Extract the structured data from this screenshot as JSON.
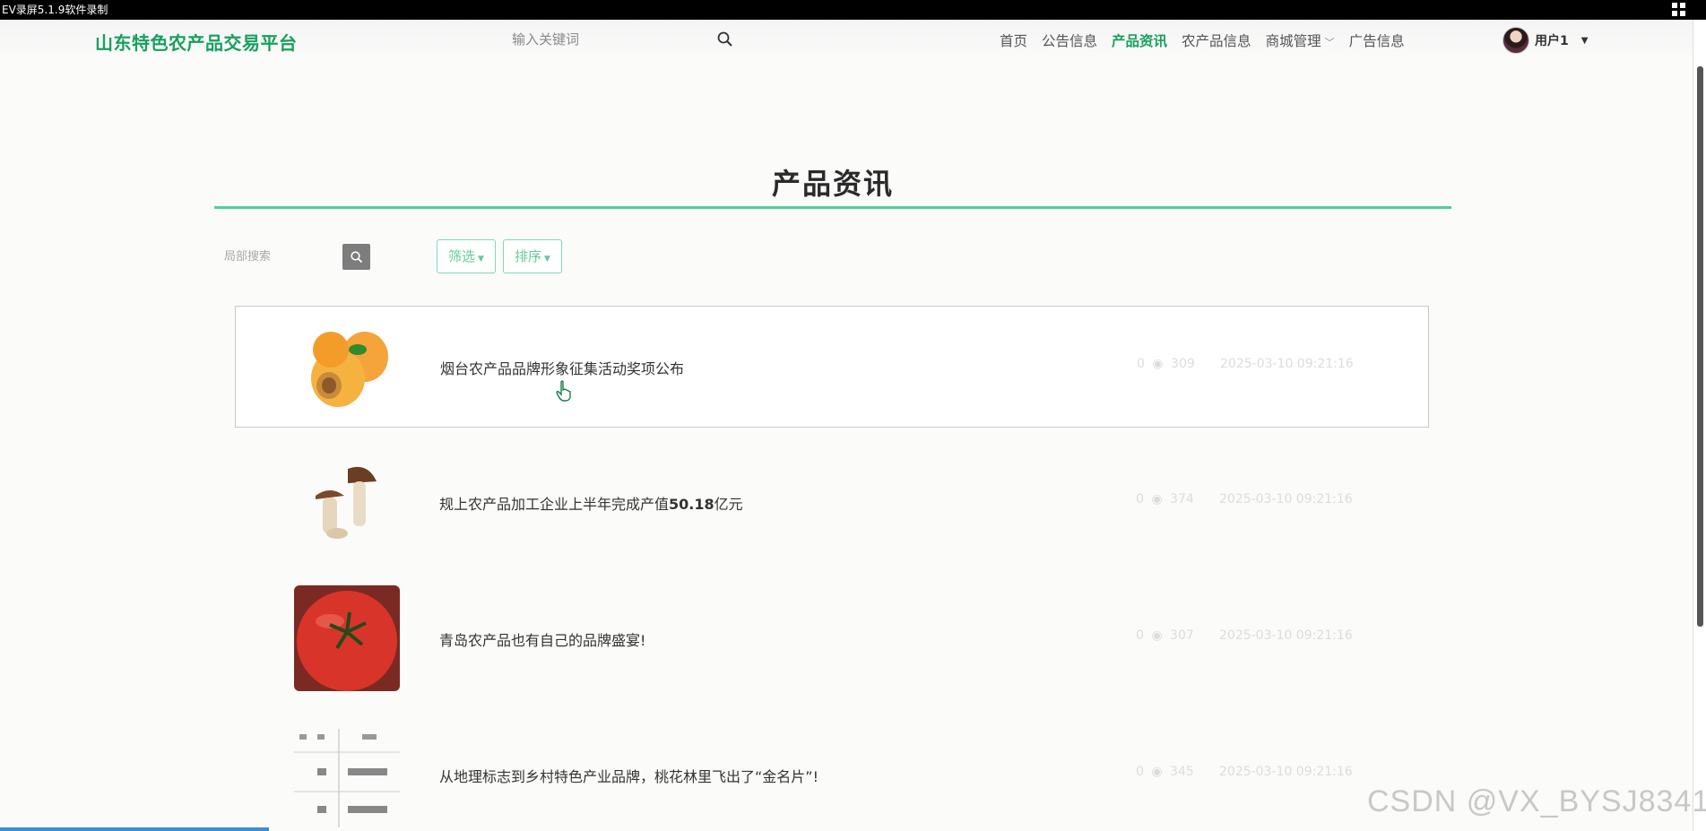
{
  "recorder": {
    "title": "EV录屏5.1.9软件录制"
  },
  "header": {
    "brand": "山东特色农产品交易平台",
    "search_placeholder": "输入关键词",
    "nav": [
      {
        "label": "首页",
        "active": false
      },
      {
        "label": "公告信息",
        "active": false
      },
      {
        "label": "产品资讯",
        "active": true
      },
      {
        "label": "农产品信息",
        "active": false
      },
      {
        "label": "商城管理",
        "active": false,
        "dropdown": true
      },
      {
        "label": "广告信息",
        "active": false
      }
    ],
    "user": {
      "name": "用户1"
    }
  },
  "page": {
    "title": "产品资讯",
    "local_search_placeholder": "局部搜索",
    "filter_label": "筛选",
    "sort_label": "排序"
  },
  "news": [
    {
      "title": "烟台农产品品牌形象征集活动奖项公布",
      "likes": "0",
      "views": "309",
      "date": "2025-03-10 09:21:16",
      "image": "apricot"
    },
    {
      "title_pre": "规上农产品加工企业上半年完成产值",
      "title_bold": "50.18",
      "title_post": "亿元",
      "likes": "0",
      "views": "374",
      "date": "2025-03-10 09:21:16",
      "image": "mushroom"
    },
    {
      "title": "青岛农产品也有自己的品牌盛宴!",
      "likes": "0",
      "views": "307",
      "date": "2025-03-10 09:21:16",
      "image": "tomato"
    },
    {
      "title": "从地理标志到乡村特色产业品牌，桃花林里飞出了“金名片”!",
      "likes": "0",
      "views": "345",
      "date": "2025-03-10 09:21:16",
      "image": "document"
    }
  ],
  "watermark": "CSDN @VX_BYSJ8341",
  "colors": {
    "brand_green": "#17a05d",
    "accent": "#4fcf9a"
  }
}
